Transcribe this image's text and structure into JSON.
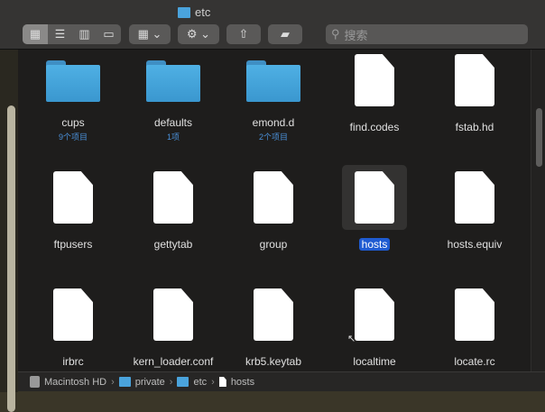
{
  "window": {
    "title": "etc"
  },
  "toolbar": {
    "search_placeholder": "搜索"
  },
  "items": [
    {
      "name": "cups",
      "sub": "9个项目",
      "type": "folder"
    },
    {
      "name": "defaults",
      "sub": "1项",
      "type": "folder"
    },
    {
      "name": "emond.d",
      "sub": "2个项目",
      "type": "folder"
    },
    {
      "name": "find.codes",
      "type": "file"
    },
    {
      "name": "fstab.hd",
      "type": "file"
    },
    {
      "name": "ftpusers",
      "type": "file"
    },
    {
      "name": "gettytab",
      "type": "file"
    },
    {
      "name": "group",
      "type": "file"
    },
    {
      "name": "hosts",
      "type": "file",
      "selected": true
    },
    {
      "name": "hosts.equiv",
      "type": "file"
    },
    {
      "name": "irbrc",
      "type": "file"
    },
    {
      "name": "kern_loader.conf",
      "type": "file"
    },
    {
      "name": "krb5.keytab",
      "type": "file"
    },
    {
      "name": "localtime",
      "type": "file"
    },
    {
      "name": "locate.rc",
      "type": "file"
    }
  ],
  "path_bar": [
    "Macintosh HD",
    "private",
    "etc",
    "hosts"
  ]
}
